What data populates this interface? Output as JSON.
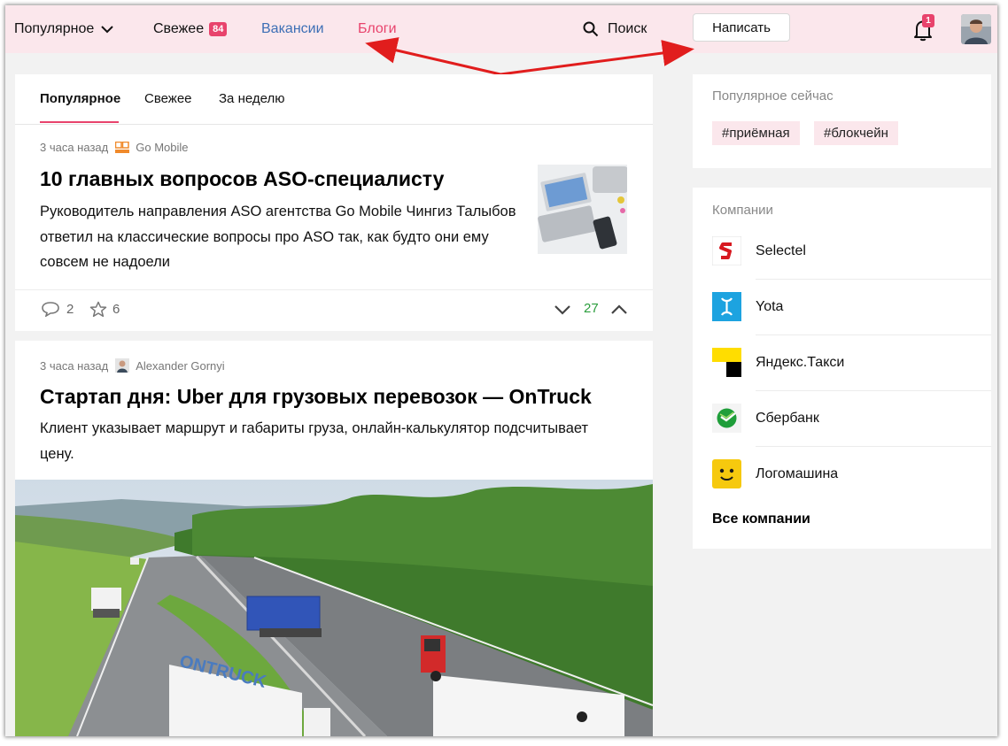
{
  "header": {
    "popular_label": "Популярное",
    "fresh_label": "Свежее",
    "fresh_count": "84",
    "vacancies_label": "Вакансии",
    "blogs_label": "Блоги",
    "search_label": "Поиск",
    "write_label": "Написать",
    "notifications_count": "1"
  },
  "feed": {
    "tabs": [
      "Популярное",
      "Свежее",
      "За неделю"
    ],
    "active_tab": "Популярное",
    "posts": [
      {
        "time": "3 часа назад",
        "author": "Go Mobile",
        "title": "10 главных вопросов ASO-специалисту",
        "lead": "Руководитель направления ASO агентства Go Mobile Чингиз Талыбов ответил на классические вопросы про ASO так, как будто они ему совсем не надоели",
        "comments": "2",
        "favorites": "6",
        "rating": "27"
      },
      {
        "time": "3 часа назад",
        "author": "Alexander Gornyi",
        "title": "Стартап дня: Uber для грузовых перевозок — OnTruck",
        "lead": "Клиент указывает маршрут и габариты груза, онлайн-калькулятор подсчитывает цену.",
        "photo_caption": "ONTRUCK"
      }
    ]
  },
  "sidebar": {
    "popular_now_label": "Популярное сейчас",
    "tags": [
      "#приёмная",
      "#блокчейн"
    ],
    "companies_label": "Компании",
    "companies": [
      {
        "name": "Selectel",
        "icon": "selectel-logo"
      },
      {
        "name": "Yota",
        "icon": "yota-logo"
      },
      {
        "name": "Яндекс.Такси",
        "icon": "yandex-taxi-logo"
      },
      {
        "name": "Сбербанк",
        "icon": "sberbank-logo"
      },
      {
        "name": "Логомашина",
        "icon": "logomashina-logo"
      }
    ],
    "all_companies_label": "Все компании"
  },
  "colors": {
    "accent": "#e8436c",
    "header_bg": "#fbe7ec",
    "link_blue": "#3d6fb5",
    "rating_green": "#2a9d3c",
    "annotation_red": "#e11d1d"
  }
}
